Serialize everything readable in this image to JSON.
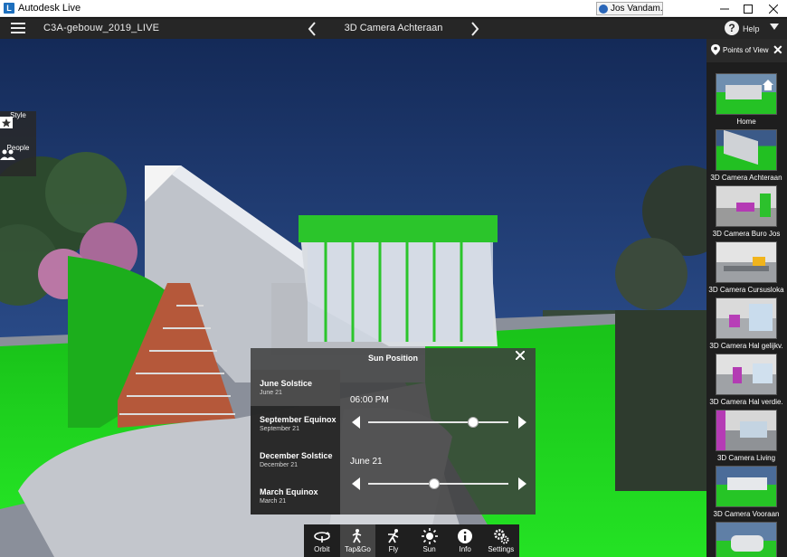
{
  "window": {
    "title": "Autodesk Live",
    "logo_letter": "L",
    "user": "Jos Vandam..."
  },
  "header": {
    "project_title": "C3A-gebouw_2019_LIVE",
    "view_title": "3D Camera Achteraan",
    "help_label": "Help",
    "prev_glyph": "‹",
    "next_glyph": "›"
  },
  "left_tools": [
    {
      "label": "Style",
      "icon": "star-tile-icon"
    },
    {
      "label": "People",
      "icon": "people-icon"
    }
  ],
  "sun_position": {
    "title": "Sun Position",
    "presets": [
      {
        "name": "June Solstice",
        "date": "June 21",
        "active": true
      },
      {
        "name": "September Equinox",
        "date": "September 21",
        "active": false
      },
      {
        "name": "December Solstice",
        "date": "December 21",
        "active": false
      },
      {
        "name": "March Equinox",
        "date": "March 21",
        "active": false
      }
    ],
    "time_label": "06:00 PM",
    "time_fraction": 0.75,
    "date_label": "June 21",
    "date_fraction": 0.47
  },
  "toolbar": [
    {
      "label": "Orbit",
      "icon": "orbit-icon",
      "active": false
    },
    {
      "label": "Tap&Go",
      "icon": "walker-icon",
      "active": true
    },
    {
      "label": "Fly",
      "icon": "fly-icon",
      "active": false
    },
    {
      "label": "Sun",
      "icon": "sun-icon",
      "active": false
    },
    {
      "label": "Info",
      "icon": "info-icon",
      "active": false
    },
    {
      "label": "Settings",
      "icon": "gears-icon",
      "active": false
    }
  ],
  "points_of_view": {
    "title": "Points of View",
    "items": [
      {
        "label": "Home"
      },
      {
        "label": "3D Camera Achteraan"
      },
      {
        "label": "3D Camera Buro Jos"
      },
      {
        "label": "3D Camera Cursusloka"
      },
      {
        "label": "3D Camera Hal gelijkv."
      },
      {
        "label": "3D Camera Hal verdie."
      },
      {
        "label": "3D Camera Living"
      },
      {
        "label": "3D Camera Vooraan"
      },
      {
        "label": ""
      }
    ]
  },
  "colors": {
    "accent_green": "#1fd21f",
    "panel_dark": "#262626",
    "sky": "#1c3566"
  }
}
